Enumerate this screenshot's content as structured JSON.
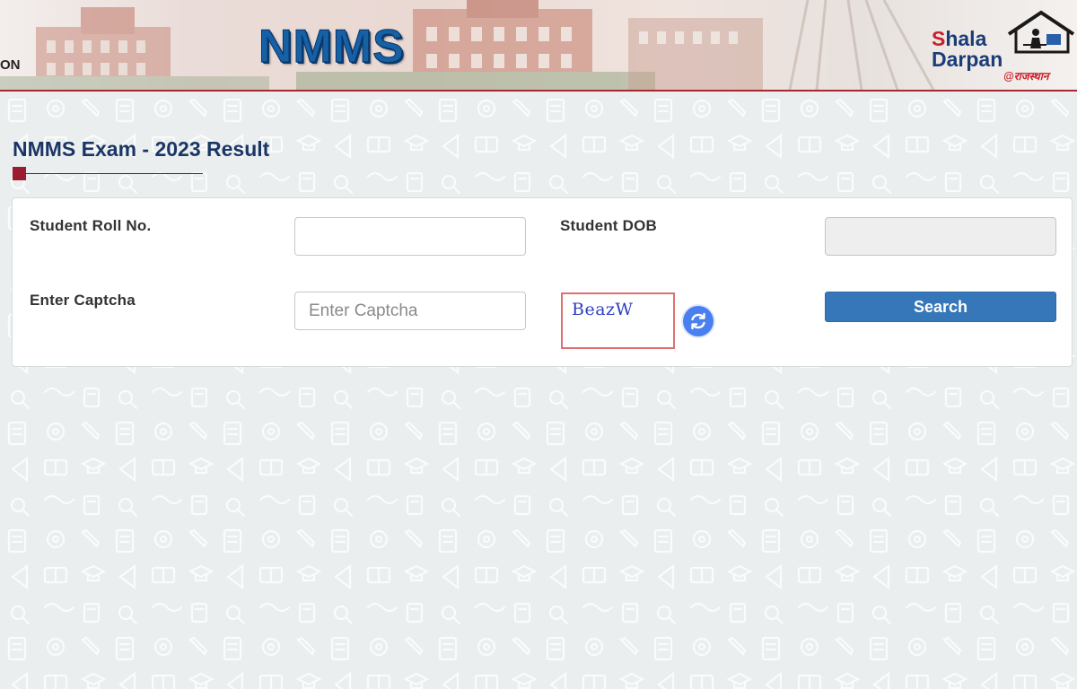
{
  "header": {
    "dept_text": "ON",
    "nmms_logo_text": "NMMS",
    "shala_logo": {
      "line1_s": "S",
      "line1_rest": "hala",
      "line2": "Darpan",
      "tagline": "@राजस्थान"
    }
  },
  "page": {
    "title": "NMMS Exam - 2023 Result"
  },
  "form": {
    "roll_label": "Student Roll No.",
    "roll_value": "",
    "dob_label": "Student DOB",
    "dob_value": "",
    "captcha_label": "Enter Captcha",
    "captcha_placeholder": "Enter Captcha",
    "captcha_image_text": "BeazW",
    "search_button": "Search"
  },
  "icons": {
    "refresh": "refresh-icon",
    "house": "house-icon"
  },
  "colors": {
    "title": "#1b3566",
    "accent": "#9b1b30",
    "search_button": "#3577b8",
    "refresh_button": "#4a7ff0",
    "captcha_border": "#e07070",
    "header_border": "#a8282f"
  }
}
